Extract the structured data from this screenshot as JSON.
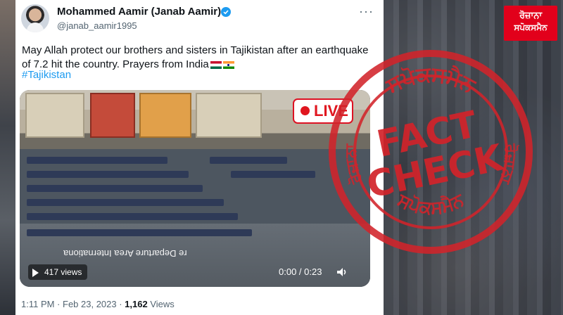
{
  "tweet": {
    "display_name": "Mohammed Aamir (Janab Aamir)",
    "handle": "@janab_aamir1995",
    "more": "···",
    "text": "May Allah protect our brothers and sisters in Tajikistan after an earthquake of 7.2 hit the country. Prayers from India",
    "hashtag": "#Tajikistan",
    "timestamp": "1:11 PM · Feb 23, 2023 · ",
    "view_count": "1,162",
    "views_label": " Views"
  },
  "video": {
    "live_label": "LIVE",
    "caption_mirrored": "re Departure Area Internationa",
    "views": "417 views",
    "time": "0:00 / 0:23",
    "controls": [
      "play-icon",
      "volume-icon",
      "settings-icon",
      "fullscreen-icon"
    ]
  },
  "stamp": {
    "top_text": "ਸਪੋਕਸਮੈਨ",
    "word1": "FACT",
    "word2": "CHECK",
    "side_text": "ਰੋਜ਼ਾਨਾ",
    "bottom_text": "ਸਪੋਕਸਮੈਨ",
    "color": "#d2232a"
  },
  "logo": {
    "line1": "ਰੋਜ਼ਾਨਾ",
    "line2": "ਸਪੋਕਸਮੈਨ",
    "color": "#e2001b"
  },
  "colors": {
    "accent": "#1d9bf0",
    "text": "#0f1419",
    "muted": "#536471"
  }
}
